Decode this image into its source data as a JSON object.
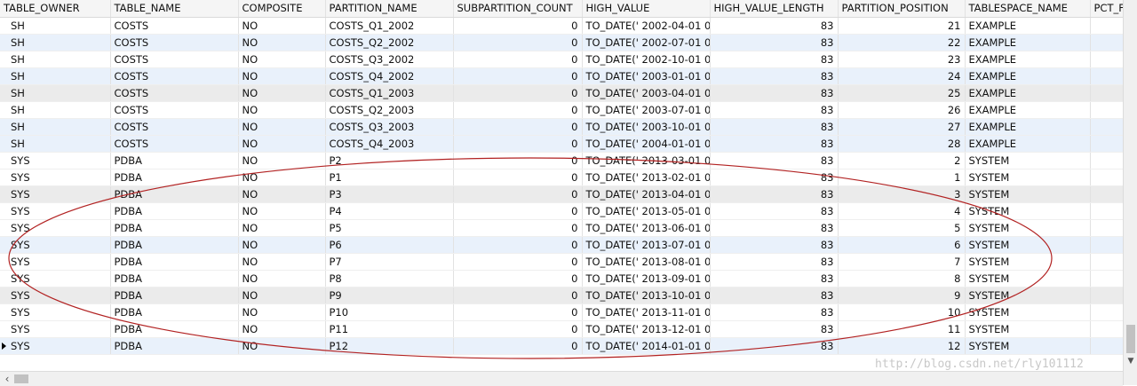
{
  "columns": [
    "TABLE_OWNER",
    "TABLE_NAME",
    "COMPOSITE",
    "PARTITION_NAME",
    "SUBPARTITION_COUNT",
    "HIGH_VALUE",
    "HIGH_VALUE_LENGTH",
    "PARTITION_POSITION",
    "TABLESPACE_NAME",
    "PCT_F"
  ],
  "rows": [
    [
      "SH",
      "COSTS",
      "NO",
      "COSTS_Q1_2002",
      "0",
      "TO_DATE(' 2002-04-01 0C",
      "83",
      "21",
      "EXAMPLE",
      ""
    ],
    [
      "SH",
      "COSTS",
      "NO",
      "COSTS_Q2_2002",
      "0",
      "TO_DATE(' 2002-07-01 0C",
      "83",
      "22",
      "EXAMPLE",
      ""
    ],
    [
      "SH",
      "COSTS",
      "NO",
      "COSTS_Q3_2002",
      "0",
      "TO_DATE(' 2002-10-01 0C",
      "83",
      "23",
      "EXAMPLE",
      ""
    ],
    [
      "SH",
      "COSTS",
      "NO",
      "COSTS_Q4_2002",
      "0",
      "TO_DATE(' 2003-01-01 0C",
      "83",
      "24",
      "EXAMPLE",
      ""
    ],
    [
      "SH",
      "COSTS",
      "NO",
      "COSTS_Q1_2003",
      "0",
      "TO_DATE(' 2003-04-01 0C",
      "83",
      "25",
      "EXAMPLE",
      ""
    ],
    [
      "SH",
      "COSTS",
      "NO",
      "COSTS_Q2_2003",
      "0",
      "TO_DATE(' 2003-07-01 0C",
      "83",
      "26",
      "EXAMPLE",
      ""
    ],
    [
      "SH",
      "COSTS",
      "NO",
      "COSTS_Q3_2003",
      "0",
      "TO_DATE(' 2003-10-01 0C",
      "83",
      "27",
      "EXAMPLE",
      ""
    ],
    [
      "SH",
      "COSTS",
      "NO",
      "COSTS_Q4_2003",
      "0",
      "TO_DATE(' 2004-01-01 0C",
      "83",
      "28",
      "EXAMPLE",
      ""
    ],
    [
      "SYS",
      "PDBA",
      "NO",
      "P2",
      "0",
      "TO_DATE(' 2013-03-01 0C",
      "83",
      "2",
      "SYSTEM",
      ""
    ],
    [
      "SYS",
      "PDBA",
      "NO",
      "P1",
      "0",
      "TO_DATE(' 2013-02-01 0C",
      "83",
      "1",
      "SYSTEM",
      ""
    ],
    [
      "SYS",
      "PDBA",
      "NO",
      "P3",
      "0",
      "TO_DATE(' 2013-04-01 0C",
      "83",
      "3",
      "SYSTEM",
      ""
    ],
    [
      "SYS",
      "PDBA",
      "NO",
      "P4",
      "0",
      "TO_DATE(' 2013-05-01 0C",
      "83",
      "4",
      "SYSTEM",
      ""
    ],
    [
      "SYS",
      "PDBA",
      "NO",
      "P5",
      "0",
      "TO_DATE(' 2013-06-01 0C",
      "83",
      "5",
      "SYSTEM",
      ""
    ],
    [
      "SYS",
      "PDBA",
      "NO",
      "P6",
      "0",
      "TO_DATE(' 2013-07-01 0C",
      "83",
      "6",
      "SYSTEM",
      ""
    ],
    [
      "SYS",
      "PDBA",
      "NO",
      "P7",
      "0",
      "TO_DATE(' 2013-08-01 0C",
      "83",
      "7",
      "SYSTEM",
      ""
    ],
    [
      "SYS",
      "PDBA",
      "NO",
      "P8",
      "0",
      "TO_DATE(' 2013-09-01 0C",
      "83",
      "8",
      "SYSTEM",
      ""
    ],
    [
      "SYS",
      "PDBA",
      "NO",
      "P9",
      "0",
      "TO_DATE(' 2013-10-01 0C",
      "83",
      "9",
      "SYSTEM",
      ""
    ],
    [
      "SYS",
      "PDBA",
      "NO",
      "P10",
      "0",
      "TO_DATE(' 2013-11-01 0C",
      "83",
      "10",
      "SYSTEM",
      ""
    ],
    [
      "SYS",
      "PDBA",
      "NO",
      "P11",
      "0",
      "TO_DATE(' 2013-12-01 0C",
      "83",
      "11",
      "SYSTEM",
      ""
    ],
    [
      "SYS",
      "PDBA",
      "NO",
      "P12",
      "0",
      "TO_DATE(' 2014-01-01 0C",
      "83",
      "12",
      "SYSTEM",
      ""
    ]
  ],
  "row_styles": [
    "a",
    "b",
    "a",
    "b",
    "g",
    "a",
    "b",
    "b",
    "a",
    "a",
    "g",
    "a",
    "a",
    "b",
    "a",
    "a",
    "g",
    "a",
    "a",
    "b"
  ],
  "current_row_index": 19,
  "annotation_color": "#b22222",
  "watermark": "http://blog.csdn.net/rly101112",
  "icons": {
    "scroll_left": "chevron-left-icon",
    "scroll_down": "chevron-down-icon",
    "current_row": "row-pointer-icon"
  }
}
